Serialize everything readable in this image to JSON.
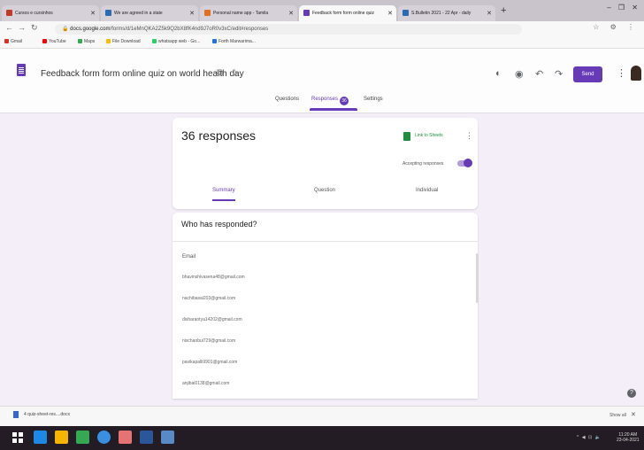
{
  "browser": {
    "tabs": [
      {
        "title": "Cursos e cursinhos",
        "favicon_color": "#c0392b"
      },
      {
        "title": "We are agreed in a state",
        "favicon_color": "#2c6bb0"
      },
      {
        "title": "Personal name app - Tamila",
        "favicon_color": "#e07020"
      },
      {
        "title": "Feedback form form online quiz",
        "favicon_color": "#673ab7",
        "active": true
      },
      {
        "title": "S.Bulletin 2021 - 22 Apr - daily",
        "favicon_color": "#2c6bb0"
      }
    ],
    "new_tab_glyph": "+",
    "window_controls": "– ❐ ✕",
    "url_host": "docs.google.com",
    "url_path": "/forms/d/1eMnQKA2Z5k9Q2bX8fK4nd9J7oR0v3xC/edit#responses",
    "nav_right_icons": "☆ ⚙ ⋮",
    "bookmarks": [
      {
        "label": "Gmail",
        "icon_color": "#d93025"
      },
      {
        "label": "YouTube",
        "icon_color": "#ff0000"
      },
      {
        "label": "Maps",
        "icon_color": "#34a853"
      },
      {
        "label": "File Download",
        "icon_color": "#fbbc05"
      },
      {
        "label": "whatsapp web - Go...",
        "icon_color": "#25d366"
      },
      {
        "label": "Forth Marwarima...",
        "icon_color": "#1a73e8"
      }
    ]
  },
  "forms": {
    "title": "Feedback form form online quiz on world health day",
    "header_icons": [
      "palette-icon",
      "eye-icon",
      "undo-icon",
      "redo-icon"
    ],
    "send_label": "Send",
    "tabs": {
      "questions": "Questions",
      "responses": "Responses",
      "responses_badge": "36",
      "settings": "Settings"
    }
  },
  "responses_card": {
    "count_text": "36 responses",
    "link_sheets_label": "Link to Sheets",
    "accepting_label": "Accepting responses",
    "accepting": true,
    "subtabs": [
      "Summary",
      "Question",
      "Individual"
    ]
  },
  "who_card": {
    "heading": "Who has responded?",
    "column_header": "Email",
    "emails": [
      "bhavinshivasena48@gmail.com",
      "nachibasai203@gmail.com",
      "disharaotya14202@gmail.com",
      "nischanbui729@gmail.com",
      "pavikapalli9901@gmail.com",
      "anjibai0138@gmail.com"
    ]
  },
  "help_glyph": "?",
  "download_shelf": {
    "file_label": "4 quiz-sheet-res....docx",
    "show_all": "Show all",
    "close_glyph": "✕"
  },
  "taskbar": {
    "apps": [
      {
        "name": "ie",
        "color": "#1e88e5"
      },
      {
        "name": "explorer",
        "color": "#f4b400"
      },
      {
        "name": "store",
        "color": "#34a853"
      },
      {
        "name": "chrome",
        "color": "#3a8fe0"
      },
      {
        "name": "photos",
        "color": "#e57373"
      },
      {
        "name": "word",
        "color": "#2b579a"
      },
      {
        "name": "window",
        "color": "#5a8ac6"
      }
    ],
    "tray_text": "^ ◀ ⊡ 🔈",
    "time": "11:20 AM",
    "date": "23-04-2021"
  }
}
